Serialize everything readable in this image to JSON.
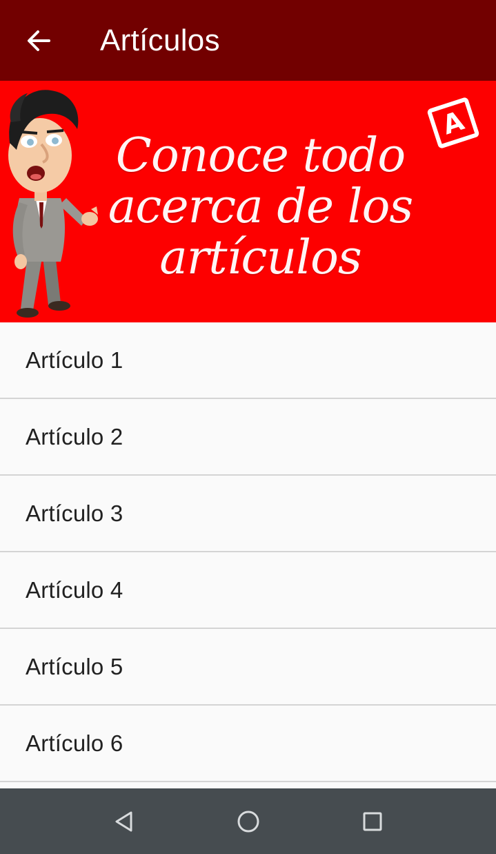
{
  "appbar": {
    "title": "Artículos",
    "back_icon": "arrow-left-icon",
    "background": "#720000"
  },
  "banner": {
    "headline": "Conoce todo\nacerca de los\nartículos",
    "badge_letter": "A",
    "background": "#fd0000"
  },
  "articles": [
    {
      "label": "Artículo 1"
    },
    {
      "label": "Artículo 2"
    },
    {
      "label": "Artículo 3"
    },
    {
      "label": "Artículo 4"
    },
    {
      "label": "Artículo 5"
    },
    {
      "label": "Artículo 6"
    }
  ],
  "navbar": {
    "buttons": [
      "back-triangle-icon",
      "home-circle-icon",
      "recents-square-icon"
    ],
    "background": "#464c50"
  }
}
